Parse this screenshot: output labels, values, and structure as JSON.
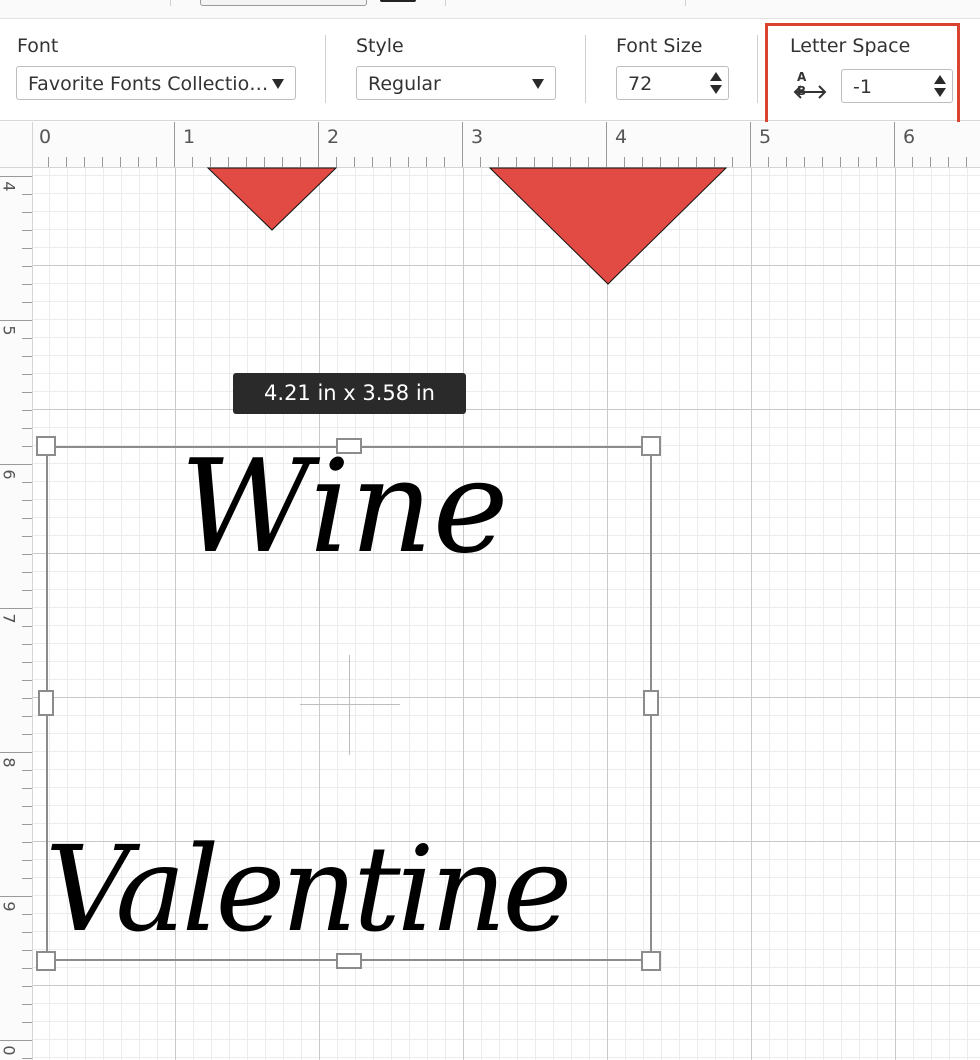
{
  "toolbar": {
    "font": {
      "label": "Font",
      "value": "Favorite Fonts Collectio…"
    },
    "style": {
      "label": "Style",
      "value": "Regular"
    },
    "font_size": {
      "label": "Font Size",
      "value": "72"
    },
    "letter_space": {
      "label": "Letter Space",
      "icon_letters": "A B",
      "value": "-1"
    }
  },
  "ruler": {
    "horizontal": [
      "0",
      "1",
      "2",
      "3",
      "4",
      "5",
      "6"
    ],
    "vertical": [
      "4",
      "5",
      "6",
      "7",
      "8",
      "9",
      "0"
    ]
  },
  "canvas": {
    "size_tooltip": "4.21  in x 3.58  in",
    "text_line1": "Wine",
    "text_line2": "Valentine",
    "shape_color": "#e24b43",
    "highlight_color": "#d9432f"
  }
}
